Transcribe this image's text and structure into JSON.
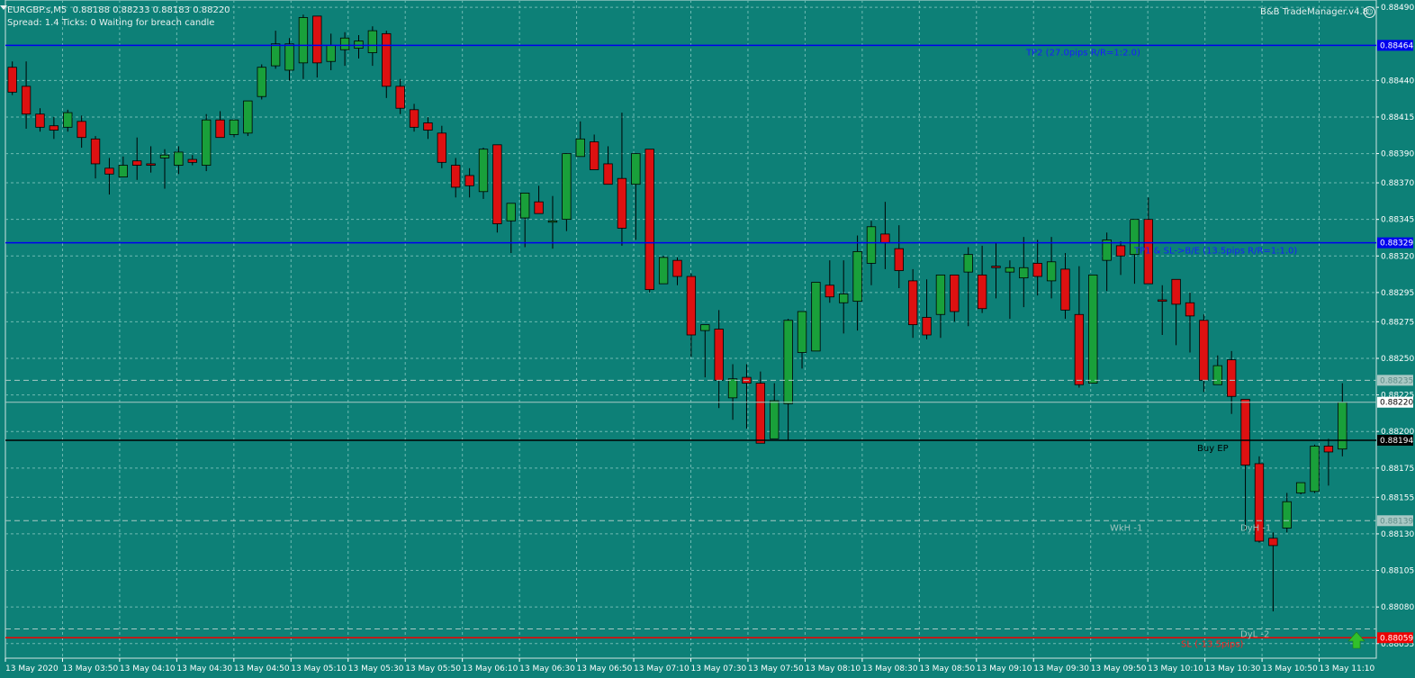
{
  "header": {
    "symbol": "EURGBP.s,M5",
    "ohlc": "0.88188 0.88233 0.88183 0.88220",
    "status": "Spread: 1.4  Ticks: 0  Waiting for breach candle",
    "brand": "B&B TradeManager.v4.8",
    "smiley_icon": "smiley-face-icon"
  },
  "colors": {
    "background": "#0d8077",
    "bull": "#19a03a",
    "bear": "#dd1111",
    "level_blue": "#0000ee",
    "level_black": "#000000",
    "level_red": "#ee0000",
    "grid": "#6fbab3",
    "axis_text": "#ffffff"
  },
  "chart_data": {
    "type": "candlestick",
    "symbol": "EURGBP.s",
    "timeframe": "M5",
    "ylim": [
      0.88045,
      0.88495
    ],
    "grid": true,
    "y_ticks": [
      "0.88490",
      "0.88440",
      "0.88415",
      "0.88390",
      "0.88370",
      "0.88345",
      "0.88320",
      "0.88295",
      "0.88275",
      "0.88250",
      "0.88225",
      "0.88200",
      "0.88175",
      "0.88155",
      "0.88130",
      "0.88105",
      "0.88080",
      "0.88055"
    ],
    "x_labels": [
      "13 May 2020",
      "13 May 03:50",
      "13 May 04:10",
      "13 May 04:30",
      "13 May 04:50",
      "13 May 05:10",
      "13 May 05:30",
      "13 May 05:50",
      "13 May 06:10",
      "13 May 06:30",
      "13 May 06:50",
      "13 May 07:10",
      "13 May 07:30",
      "13 May 07:50",
      "13 May 08:10",
      "13 May 08:30",
      "13 May 08:50",
      "13 May 09:10",
      "13 May 09:30",
      "13 May 09:50",
      "13 May 10:10",
      "13 May 10:30",
      "13 May 10:50",
      "13 May 11:10"
    ],
    "candles": [
      {
        "o": 0.88449,
        "h": 0.88453,
        "l": 0.8843,
        "c": 0.88432
      },
      {
        "o": 0.88436,
        "h": 0.88453,
        "l": 0.88407,
        "c": 0.88417
      },
      {
        "o": 0.88417,
        "h": 0.88421,
        "l": 0.88405,
        "c": 0.88408
      },
      {
        "o": 0.88409,
        "h": 0.88415,
        "l": 0.884,
        "c": 0.88406
      },
      {
        "o": 0.88408,
        "h": 0.8842,
        "l": 0.88405,
        "c": 0.88418
      },
      {
        "o": 0.88412,
        "h": 0.88416,
        "l": 0.88394,
        "c": 0.88401
      },
      {
        "o": 0.884,
        "h": 0.88402,
        "l": 0.88373,
        "c": 0.88383
      },
      {
        "o": 0.8838,
        "h": 0.88387,
        "l": 0.88362,
        "c": 0.88376
      },
      {
        "o": 0.88374,
        "h": 0.88388,
        "l": 0.88374,
        "c": 0.88382
      },
      {
        "o": 0.88385,
        "h": 0.88401,
        "l": 0.88372,
        "c": 0.88382
      },
      {
        "o": 0.88383,
        "h": 0.88395,
        "l": 0.88377,
        "c": 0.88382
      },
      {
        "o": 0.88387,
        "h": 0.88393,
        "l": 0.88366,
        "c": 0.88389
      },
      {
        "o": 0.88382,
        "h": 0.88395,
        "l": 0.88376,
        "c": 0.88391
      },
      {
        "o": 0.88386,
        "h": 0.88389,
        "l": 0.88382,
        "c": 0.88384
      },
      {
        "o": 0.88382,
        "h": 0.88417,
        "l": 0.88378,
        "c": 0.88413
      },
      {
        "o": 0.88413,
        "h": 0.88419,
        "l": 0.88401,
        "c": 0.88401
      },
      {
        "o": 0.88403,
        "h": 0.88413,
        "l": 0.88401,
        "c": 0.88413
      },
      {
        "o": 0.88404,
        "h": 0.88422,
        "l": 0.88402,
        "c": 0.88426
      },
      {
        "o": 0.88429,
        "h": 0.88451,
        "l": 0.88427,
        "c": 0.88449
      },
      {
        "o": 0.8845,
        "h": 0.88474,
        "l": 0.88448,
        "c": 0.88465
      },
      {
        "o": 0.88447,
        "h": 0.88469,
        "l": 0.8844,
        "c": 0.88465
      },
      {
        "o": 0.88452,
        "h": 0.88485,
        "l": 0.88441,
        "c": 0.88483
      },
      {
        "o": 0.88484,
        "h": 0.88484,
        "l": 0.88442,
        "c": 0.88452
      },
      {
        "o": 0.88453,
        "h": 0.88472,
        "l": 0.88447,
        "c": 0.88464
      },
      {
        "o": 0.88461,
        "h": 0.88473,
        "l": 0.8845,
        "c": 0.88469
      },
      {
        "o": 0.88462,
        "h": 0.88471,
        "l": 0.88455,
        "c": 0.88467
      },
      {
        "o": 0.88459,
        "h": 0.88477,
        "l": 0.8845,
        "c": 0.88474
      },
      {
        "o": 0.88472,
        "h": 0.88474,
        "l": 0.88428,
        "c": 0.88436
      },
      {
        "o": 0.88436,
        "h": 0.88441,
        "l": 0.88417,
        "c": 0.88421
      },
      {
        "o": 0.8842,
        "h": 0.88424,
        "l": 0.88405,
        "c": 0.88408
      },
      {
        "o": 0.88411,
        "h": 0.88415,
        "l": 0.884,
        "c": 0.88406
      },
      {
        "o": 0.88404,
        "h": 0.88409,
        "l": 0.8838,
        "c": 0.88384
      },
      {
        "o": 0.88382,
        "h": 0.88387,
        "l": 0.8836,
        "c": 0.88367
      },
      {
        "o": 0.88375,
        "h": 0.8838,
        "l": 0.8836,
        "c": 0.88368
      },
      {
        "o": 0.88364,
        "h": 0.88394,
        "l": 0.88359,
        "c": 0.88393
      },
      {
        "o": 0.88396,
        "h": 0.88396,
        "l": 0.88336,
        "c": 0.88342
      },
      {
        "o": 0.88344,
        "h": 0.88353,
        "l": 0.88322,
        "c": 0.88356
      },
      {
        "o": 0.88346,
        "h": 0.8836,
        "l": 0.88326,
        "c": 0.88363
      },
      {
        "o": 0.88357,
        "h": 0.88368,
        "l": 0.88351,
        "c": 0.88349
      },
      {
        "o": 0.88344,
        "h": 0.88361,
        "l": 0.88325,
        "c": 0.88344
      },
      {
        "o": 0.88345,
        "h": 0.88389,
        "l": 0.88337,
        "c": 0.8839
      },
      {
        "o": 0.88388,
        "h": 0.88412,
        "l": 0.8839,
        "c": 0.884
      },
      {
        "o": 0.88398,
        "h": 0.88403,
        "l": 0.8838,
        "c": 0.88379
      },
      {
        "o": 0.88383,
        "h": 0.88395,
        "l": 0.88375,
        "c": 0.88369
      },
      {
        "o": 0.88373,
        "h": 0.88418,
        "l": 0.88327,
        "c": 0.88339
      },
      {
        "o": 0.88369,
        "h": 0.88389,
        "l": 0.88331,
        "c": 0.8839
      },
      {
        "o": 0.88393,
        "h": 0.88391,
        "l": 0.88295,
        "c": 0.88297
      },
      {
        "o": 0.88301,
        "h": 0.8832,
        "l": 0.88301,
        "c": 0.88319
      },
      {
        "o": 0.88317,
        "h": 0.88319,
        "l": 0.883,
        "c": 0.88306
      },
      {
        "o": 0.88306,
        "h": 0.88308,
        "l": 0.88251,
        "c": 0.88266
      },
      {
        "o": 0.88269,
        "h": 0.88273,
        "l": 0.88237,
        "c": 0.88273
      },
      {
        "o": 0.8827,
        "h": 0.88283,
        "l": 0.88216,
        "c": 0.88235
      },
      {
        "o": 0.88223,
        "h": 0.88246,
        "l": 0.88208,
        "c": 0.88236
      },
      {
        "o": 0.88237,
        "h": 0.88246,
        "l": 0.88202,
        "c": 0.88233
      },
      {
        "o": 0.88233,
        "h": 0.88241,
        "l": 0.88194,
        "c": 0.88192
      },
      {
        "o": 0.88195,
        "h": 0.88233,
        "l": 0.88196,
        "c": 0.88221
      },
      {
        "o": 0.88219,
        "h": 0.88277,
        "l": 0.88194,
        "c": 0.88276
      },
      {
        "o": 0.88254,
        "h": 0.8828,
        "l": 0.88243,
        "c": 0.88282
      },
      {
        "o": 0.88255,
        "h": 0.88302,
        "l": 0.88265,
        "c": 0.88302
      },
      {
        "o": 0.883,
        "h": 0.88317,
        "l": 0.88288,
        "c": 0.88292
      },
      {
        "o": 0.88288,
        "h": 0.88317,
        "l": 0.88267,
        "c": 0.88294
      },
      {
        "o": 0.88289,
        "h": 0.88334,
        "l": 0.88269,
        "c": 0.88323
      },
      {
        "o": 0.88315,
        "h": 0.88344,
        "l": 0.883,
        "c": 0.8834
      },
      {
        "o": 0.88335,
        "h": 0.88357,
        "l": 0.88311,
        "c": 0.88329
      },
      {
        "o": 0.88325,
        "h": 0.88341,
        "l": 0.88298,
        "c": 0.8831
      },
      {
        "o": 0.88303,
        "h": 0.88311,
        "l": 0.88264,
        "c": 0.88273
      },
      {
        "o": 0.88278,
        "h": 0.88304,
        "l": 0.88263,
        "c": 0.88266
      },
      {
        "o": 0.8828,
        "h": 0.88305,
        "l": 0.88264,
        "c": 0.88307
      },
      {
        "o": 0.88307,
        "h": 0.88307,
        "l": 0.88275,
        "c": 0.88282
      },
      {
        "o": 0.88309,
        "h": 0.88326,
        "l": 0.88272,
        "c": 0.88321
      },
      {
        "o": 0.88307,
        "h": 0.88327,
        "l": 0.88281,
        "c": 0.88284
      },
      {
        "o": 0.88313,
        "h": 0.88329,
        "l": 0.88291,
        "c": 0.88312
      },
      {
        "o": 0.88309,
        "h": 0.88317,
        "l": 0.88277,
        "c": 0.88312
      },
      {
        "o": 0.88305,
        "h": 0.88333,
        "l": 0.88285,
        "c": 0.88312
      },
      {
        "o": 0.88315,
        "h": 0.88331,
        "l": 0.88293,
        "c": 0.88306
      },
      {
        "o": 0.88303,
        "h": 0.88333,
        "l": 0.88291,
        "c": 0.88316
      },
      {
        "o": 0.88311,
        "h": 0.88322,
        "l": 0.88277,
        "c": 0.88283
      },
      {
        "o": 0.8828,
        "h": 0.88313,
        "l": 0.8823,
        "c": 0.88232
      },
      {
        "o": 0.88233,
        "h": 0.88304,
        "l": 0.88234,
        "c": 0.88307
      },
      {
        "o": 0.88317,
        "h": 0.88336,
        "l": 0.88296,
        "c": 0.88331
      },
      {
        "o": 0.88327,
        "h": 0.8833,
        "l": 0.88307,
        "c": 0.8832
      },
      {
        "o": 0.88321,
        "h": 0.88343,
        "l": 0.88301,
        "c": 0.88345
      },
      {
        "o": 0.88345,
        "h": 0.8836,
        "l": 0.88306,
        "c": 0.88301
      },
      {
        "o": 0.8829,
        "h": 0.883,
        "l": 0.88266,
        "c": 0.88289
      },
      {
        "o": 0.88304,
        "h": 0.88292,
        "l": 0.88259,
        "c": 0.88287
      },
      {
        "o": 0.88288,
        "h": 0.88295,
        "l": 0.88254,
        "c": 0.88279
      },
      {
        "o": 0.88276,
        "h": 0.8828,
        "l": 0.88227,
        "c": 0.88235
      },
      {
        "o": 0.88232,
        "h": 0.88252,
        "l": 0.88232,
        "c": 0.88245
      },
      {
        "o": 0.88249,
        "h": 0.88255,
        "l": 0.88212,
        "c": 0.88224
      },
      {
        "o": 0.88222,
        "h": 0.88222,
        "l": 0.88132,
        "c": 0.88177
      },
      {
        "o": 0.88178,
        "h": 0.88183,
        "l": 0.88124,
        "c": 0.88125
      },
      {
        "o": 0.88127,
        "h": 0.88131,
        "l": 0.88077,
        "c": 0.88122
      },
      {
        "o": 0.88134,
        "h": 0.88158,
        "l": 0.88131,
        "c": 0.88152
      },
      {
        "o": 0.88158,
        "h": 0.88165,
        "l": 0.88157,
        "c": 0.88165
      },
      {
        "o": 0.88159,
        "h": 0.88191,
        "l": 0.88158,
        "c": 0.8819
      },
      {
        "o": 0.8819,
        "h": 0.88195,
        "l": 0.88163,
        "c": 0.88186
      },
      {
        "o": 0.88188,
        "h": 0.88233,
        "l": 0.88183,
        "c": 0.8822
      }
    ],
    "levels": [
      {
        "name": "tp2",
        "price": 0.88464,
        "price_label": "0.88464",
        "label": "TP2 (27.0pips R/R=1:2.0)",
        "style": "solid-blue"
      },
      {
        "name": "tp1",
        "price": 0.88329,
        "price_label": "0.88329",
        "label": "TP1 & SL->B/E (13.5pips R/R=1:1.0)",
        "style": "solid-blue"
      },
      {
        "name": "buy-ep",
        "price": 0.88194,
        "price_label": "0.88194",
        "label": "Buy EP",
        "style": "solid-black"
      },
      {
        "name": "sl",
        "price": 0.88059,
        "price_label": "0.88059",
        "label": "SL (-13.5pips)",
        "style": "solid-red"
      },
      {
        "name": "dashed-high",
        "price": 0.88235,
        "price_label": "0.88235",
        "label": "",
        "style": "dashed-gray"
      },
      {
        "name": "current",
        "price": 0.8822,
        "price_label": "0.88220",
        "label": "",
        "style": "thin-gray"
      },
      {
        "name": "wkh",
        "price": 0.88139,
        "price_label": "0.88139",
        "label": "WkH -1",
        "style": "dashed-gray"
      },
      {
        "name": "dyl",
        "price": 0.88065,
        "price_label": "",
        "label": "DyL -2",
        "style": "dashed-gray"
      }
    ],
    "dyh_label": "DyH -1",
    "buy_arrow_icon": "green-up-arrow-icon"
  }
}
